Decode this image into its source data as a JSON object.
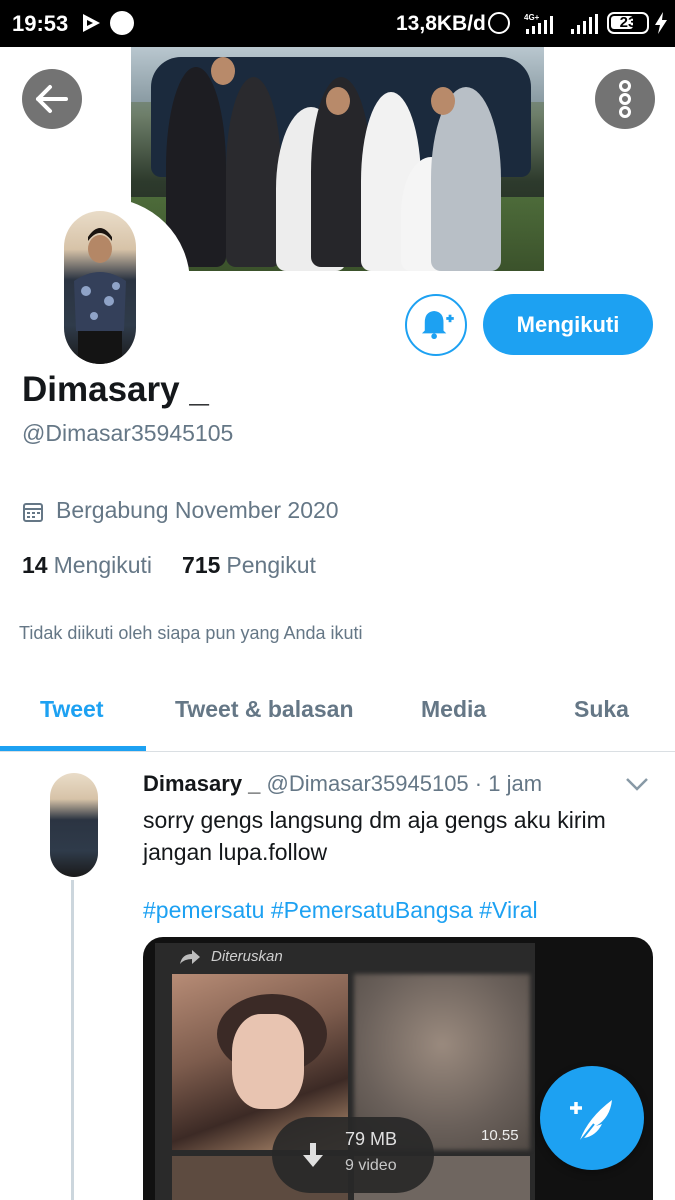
{
  "status_bar": {
    "time": "19:53",
    "net_speed": "13,8KB/d",
    "battery": "23",
    "icons": [
      "play-icon",
      "whatsapp-icon",
      "alarm-icon",
      "4g-icon",
      "signal-icon",
      "battery-icon",
      "charging-icon"
    ]
  },
  "profile": {
    "name": "Dimasary _",
    "handle": "@Dimasar35945105",
    "joined": "Bergabung November 2020",
    "following_count": "14",
    "following_label": "Mengikuti",
    "followers_count": "715",
    "followers_label": "Pengikut",
    "not_followed_note": "Tidak diikuti oleh siapa pun yang Anda ikuti",
    "follow_button_label": "Mengikuti"
  },
  "tabs": [
    {
      "label": "Tweet",
      "active": true
    },
    {
      "label": "Tweet & balasan",
      "active": false
    },
    {
      "label": "Media",
      "active": false
    },
    {
      "label": "Suka",
      "active": false
    }
  ],
  "tweet": {
    "name": "Dimasary _",
    "handle": "@Dimasar35945105",
    "separator": " · ",
    "time": "1 jam",
    "text": "sorry gengs langsung dm aja gengs aku kirim jangan lupa.follow",
    "hashtags": "#pemersatu #PemersatuBangsa #Viral",
    "media": {
      "forwarded_label": "Diteruskan",
      "video_duration": "10.55",
      "download_size": "79 MB",
      "download_count": "9 video"
    }
  },
  "colors": {
    "accent": "#1da1f2",
    "text_primary": "#14171a",
    "text_secondary": "#657786"
  }
}
